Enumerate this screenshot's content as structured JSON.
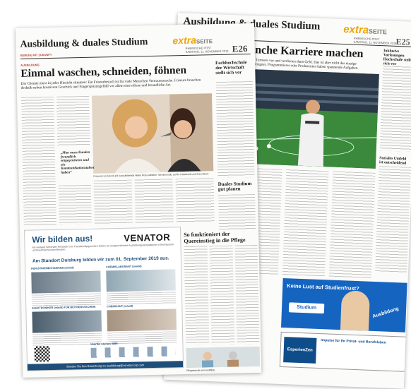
{
  "back_page": {
    "section_title": "Ausbildung & duales Studium",
    "brand_extra": "extra",
    "brand_seite": "SEITE",
    "paper_name": "RHEINISCHE POST",
    "date": "SAMSTAG, 11. NOVEMBER 2019",
    "page_no": "E25",
    "headline": "ranche Karriere machen",
    "deck": "uen auf Turniere vor und verdienen dann Geld. Das ist aber nicht das einzige\nAuch Designer, Programmierer oder Produzenten haben spannende Aufgaben.",
    "side_head": "Inklusive Vorlesungen Hochschule stellt sich vor",
    "side_head2": "Soziales Umfeld ist entscheidend",
    "ad1_text": "Keine Lust auf Studienfrust?",
    "ad1_word": "Studium",
    "ad1_word2": "Ausbildung",
    "ad2_logo": "EsperienZen",
    "ad2_text": "Impulse für Ihr Privat- und Berufsleben"
  },
  "front_page": {
    "section_title": "Ausbildung & duales Studium",
    "brand_extra": "extra",
    "brand_seite": "SEITE",
    "paper_name": "RHEINISCHE POST",
    "date": "SAMSTAG, 11. NOVEMBER 2019",
    "page_no": "E26",
    "subline": "BERUFE MIT ZUKUNFT",
    "kicker": "AUSBILDUNG",
    "headline": "Einmal waschen, schneiden, föhnen",
    "deck": "Die Chemie muss in jeder Hinsicht stimmen: Ein Friseurbesuch ist für viele Menschen Vertrauenssache. Friseure brauchen deshalb neben kreativem Geschick und Fingerspitzengefühl vor allem eine offene und freundliche Art.",
    "photo_caption": "Friseurin Lis Arend und Auszubildende Helen Roux arbeiten. Sie sind stolz auf ihr Handwerk und ihren Beruf.",
    "pull_quote": "„Man muss Kunden freundlich entgegentreten und ein Kommunikationstalent haben“",
    "side_head1": "Fachhochschule der Wirtschaft stellt sich vor",
    "side_head2": "Duales Studium gut planen",
    "feature_head": "So funktioniert der Quereinstieg in die Pflege",
    "feature_caption": "Pflegeberufe sind vielfältig."
  },
  "ad": {
    "title": "Wir bilden aus!",
    "brand": "VENATOR",
    "subtitle": "Als weltweit führender Hersteller von Titandioxidpigmenten bieten wir ausgezeichnete Ausbildungsperspektiven in technischen und kaufmännischen Berufen.",
    "site_line": "Am Standort Duisburg bilden wir zum 01. September 2019 aus.",
    "jobs": [
      {
        "title": "INDUSTRIEMECHANIKER (m/w/d)"
      },
      {
        "title": "CHEMIELABORANT (m/w/d)"
      },
      {
        "title": "ELEKTRONIKER (m/w/d) FÜR BETRIEBSTECHNIK"
      },
      {
        "title": "CHEMIKANT (m/w/d)"
      }
    ],
    "badge": "Hierfür stehen WIR:",
    "footer": "Senden Sie Ihre Bewerbung an ausbildung@venatorcorp.com"
  }
}
